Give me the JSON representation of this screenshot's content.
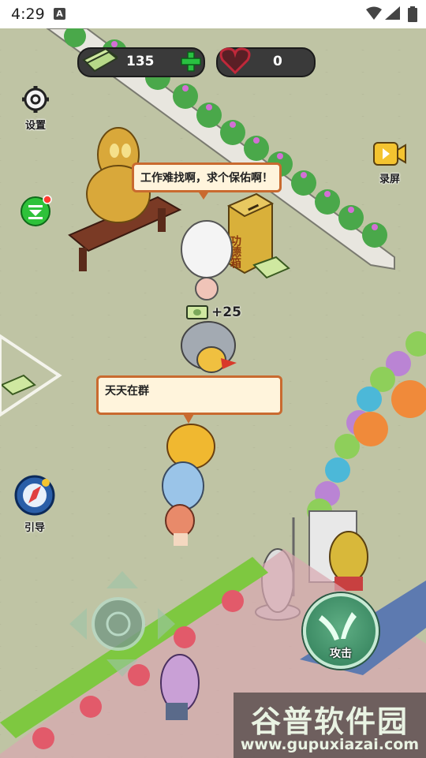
{
  "status_bar": {
    "time": "4:29",
    "notification_icon": "A"
  },
  "hud": {
    "money": "135",
    "hearts": "0"
  },
  "side_buttons": {
    "settings_label": "设置",
    "record_label": "录屏",
    "guide_label": "引导"
  },
  "npc_speech": "工作难找啊，求个保佑啊！",
  "donation_box_text": "功德箱",
  "reward_text": "+25",
  "player_speech": "天天在群",
  "attack_label": "攻击",
  "watermark": {
    "title": "谷普软件园",
    "url": "www.gupuxiazai.com"
  },
  "colors": {
    "grass": "#bfc4a4",
    "hud_bg": "#3a3a3a",
    "accent_green": "#29c041",
    "speech_border": "#c96a2f"
  }
}
